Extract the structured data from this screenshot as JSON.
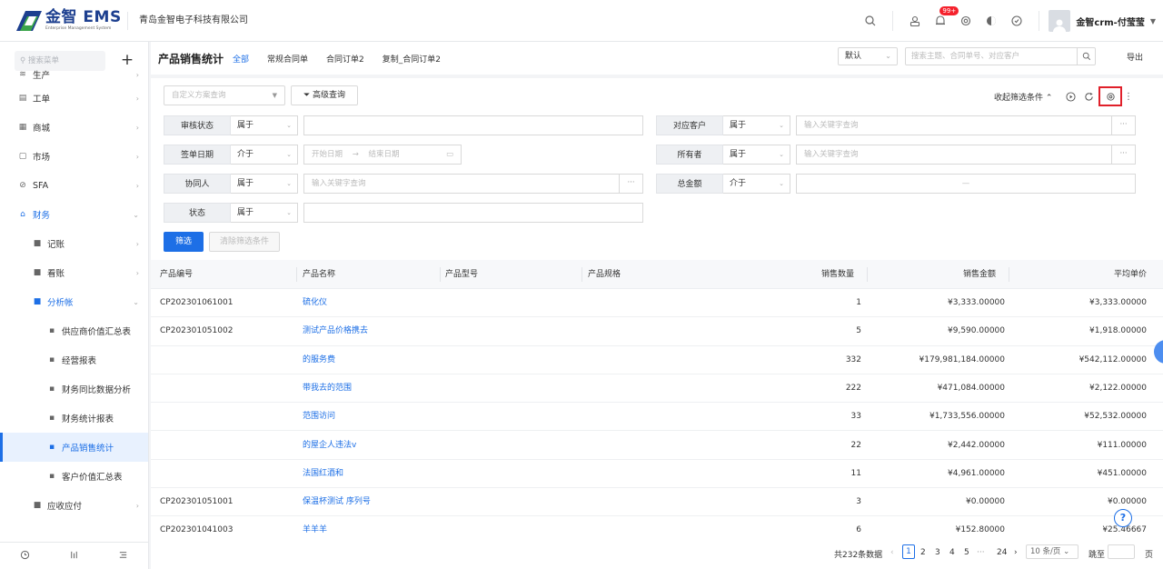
{
  "header": {
    "logo_text": "金智 EMS",
    "logo_sub": "Enterprise Management System",
    "company": "青岛金智电子科技有限公司",
    "badge": "99+",
    "username": "金智crm-付莹莹"
  },
  "sidebar": {
    "search_placeholder": "搜索菜单",
    "items": [
      {
        "label": "生产",
        "icon": "≋"
      },
      {
        "label": "工单",
        "icon": "▤"
      },
      {
        "label": "商城",
        "icon": "▦"
      },
      {
        "label": "市场",
        "icon": "▢"
      },
      {
        "label": "SFA",
        "icon": "⊘"
      },
      {
        "label": "财务",
        "icon": "⌂"
      },
      {
        "label": "记账",
        "icon": "■"
      },
      {
        "label": "看账",
        "icon": "■"
      },
      {
        "label": "分析帐",
        "icon": "■"
      },
      {
        "label": "供应商价值汇总表",
        "icon": "▪"
      },
      {
        "label": "经营报表",
        "icon": "▪"
      },
      {
        "label": "财务同比数据分析",
        "icon": "▪"
      },
      {
        "label": "财务统计报表",
        "icon": "▪"
      },
      {
        "label": "产品销售统计",
        "icon": "▪"
      },
      {
        "label": "客户价值汇总表",
        "icon": "▪"
      },
      {
        "label": "应收应付",
        "icon": "■"
      }
    ]
  },
  "topbar": {
    "title": "产品销售统计",
    "tabs": [
      "全部",
      "常规合同单",
      "合同订单2",
      "复制_合同订单2"
    ],
    "view": "默认",
    "search_placeholder": "搜索主题、合同单号、对应客户",
    "export": "导出"
  },
  "filters": {
    "custom_query": "自定义方案查询",
    "advanced": "高级查询",
    "collapse": "收起筛选条件",
    "rows": [
      {
        "label": "审核状态",
        "op": "属于",
        "value": ""
      },
      {
        "label": "对应客户",
        "op": "属于",
        "value": "输入关键字查询"
      },
      {
        "label": "签单日期",
        "op": "介于",
        "start": "开始日期",
        "end": "结束日期"
      },
      {
        "label": "所有者",
        "op": "属于",
        "value": "输入关键字查询"
      },
      {
        "label": "协同人",
        "op": "属于",
        "value": "输入关键字查询"
      },
      {
        "label": "总金额",
        "op": "介于",
        "value": "—"
      },
      {
        "label": "状态",
        "op": "属于",
        "value": ""
      }
    ],
    "filter_btn": "筛选",
    "clear_btn": "清除筛选条件"
  },
  "table": {
    "headers": [
      "产品编号",
      "产品名称",
      "产品型号",
      "产品规格",
      "销售数量",
      "销售金额",
      "平均单价"
    ],
    "rows": [
      {
        "code": "CP202301061001",
        "name": "硫化仪",
        "qty": "1",
        "amount": "¥3,333.00000",
        "avg": "¥3,333.00000"
      },
      {
        "code": "CP202301051002",
        "name": "测试产品价格携去",
        "qty": "5",
        "amount": "¥9,590.00000",
        "avg": "¥1,918.00000"
      },
      {
        "code": "",
        "name": "的服务费",
        "qty": "332",
        "amount": "¥179,981,184.00000",
        "avg": "¥542,112.00000"
      },
      {
        "code": "",
        "name": "带我去的范围",
        "qty": "222",
        "amount": "¥471,084.00000",
        "avg": "¥2,122.00000"
      },
      {
        "code": "",
        "name": "范围访问",
        "qty": "33",
        "amount": "¥1,733,556.00000",
        "avg": "¥52,532.00000"
      },
      {
        "code": "",
        "name": "的屋企人违法v",
        "qty": "22",
        "amount": "¥2,442.00000",
        "avg": "¥111.00000"
      },
      {
        "code": "",
        "name": "法国红酒和",
        "qty": "11",
        "amount": "¥4,961.00000",
        "avg": "¥451.00000"
      },
      {
        "code": "CP202301051001",
        "name": "保温杯测试 序列号",
        "qty": "3",
        "amount": "¥0.00000",
        "avg": "¥0.00000"
      },
      {
        "code": "CP202301041003",
        "name": "羊羊羊",
        "qty": "6",
        "amount": "¥152.80000",
        "avg": "¥25.46667"
      }
    ]
  },
  "pager": {
    "total": "共232条数据",
    "pages": [
      "1",
      "2",
      "3",
      "4",
      "5",
      "···",
      "24"
    ],
    "size": "10 条/页",
    "jump_label": "跳至",
    "page_unit": "页"
  },
  "help": "?"
}
